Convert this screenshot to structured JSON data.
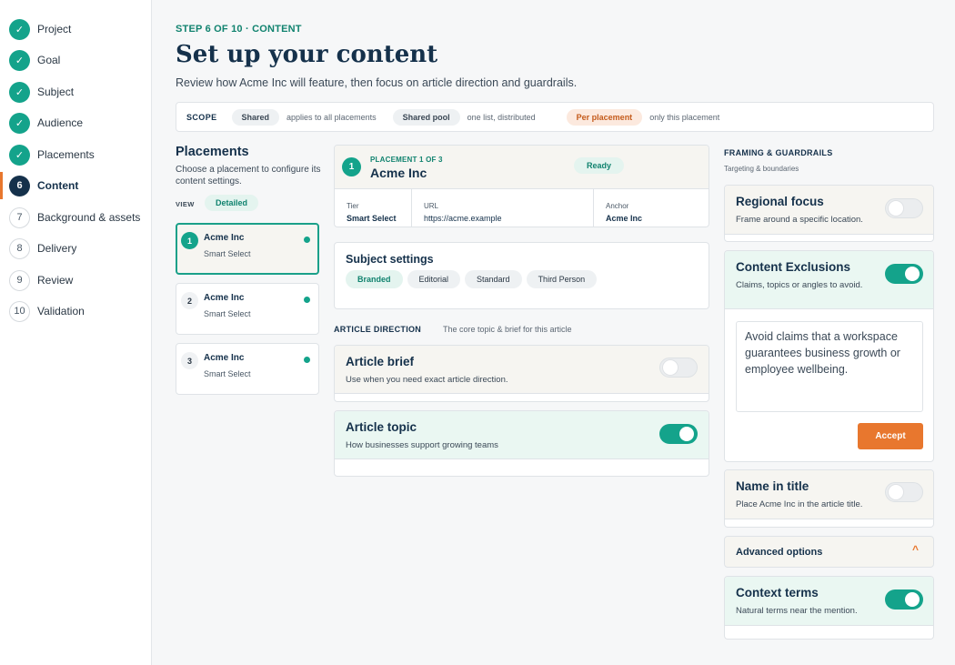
{
  "sidebar": {
    "steps": [
      {
        "num": "1",
        "label": "Project",
        "state": "done"
      },
      {
        "num": "2",
        "label": "Goal",
        "state": "done"
      },
      {
        "num": "3",
        "label": "Subject",
        "state": "done"
      },
      {
        "num": "4",
        "label": "Audience",
        "state": "done"
      },
      {
        "num": "5",
        "label": "Placements",
        "state": "done"
      },
      {
        "num": "6",
        "label": "Content",
        "state": "active"
      },
      {
        "num": "7",
        "label": "Background & assets",
        "state": "pending"
      },
      {
        "num": "8",
        "label": "Delivery",
        "state": "pending"
      },
      {
        "num": "9",
        "label": "Review",
        "state": "pending"
      },
      {
        "num": "10",
        "label": "Validation",
        "state": "pending"
      }
    ],
    "check": "✓"
  },
  "header": {
    "eyebrow": "STEP 6 OF 10 · CONTENT",
    "title": "Set up your content",
    "subtitle": "Review how Acme Inc will feature, then focus on article direction and guardrails."
  },
  "scope": {
    "label": "SCOPE",
    "shared": "Shared",
    "shared_desc": "applies to all placements",
    "pool": "Shared pool",
    "pool_desc": "one list, distributed",
    "per": "Per placement",
    "per_desc": "only this placement"
  },
  "placements": {
    "title": "Placements",
    "desc": "Choose a placement to configure its content settings.",
    "view_label": "VIEW",
    "view_value": "Detailed",
    "items": [
      {
        "num": "1",
        "name": "Acme Inc",
        "tier": "Smart Select"
      },
      {
        "num": "2",
        "name": "Acme Inc",
        "tier": "Smart Select"
      },
      {
        "num": "3",
        "name": "Acme Inc",
        "tier": "Smart Select"
      }
    ]
  },
  "placement_detail": {
    "num": "1",
    "eyebrow": "PLACEMENT 1 OF 3",
    "name": "Acme Inc",
    "status": "Ready",
    "tier_label": "Tier",
    "tier_value": "Smart Select",
    "url_label": "URL",
    "url_value": "https://acme.example",
    "anchor_label": "Anchor",
    "anchor_value": "Acme Inc"
  },
  "subject_settings": {
    "title": "Subject settings",
    "tags": [
      "Branded",
      "Editorial",
      "Standard",
      "Third Person"
    ]
  },
  "article_direction": {
    "label": "ARTICLE DIRECTION",
    "desc": "The core topic & brief for this article",
    "brief": {
      "title": "Article brief",
      "desc": "Use when you need exact article direction.",
      "on": false
    },
    "topic": {
      "title": "Article topic",
      "desc": "How businesses support growing teams",
      "on": true
    }
  },
  "framing": {
    "label": "FRAMING & GUARDRAILS",
    "desc": "Targeting & boundaries",
    "regional": {
      "title": "Regional focus",
      "desc": "Frame around a specific location.",
      "on": false
    },
    "exclusions": {
      "title": "Content Exclusions",
      "desc": "Claims, topics or angles to avoid.",
      "on": true,
      "text": "Avoid claims that a workspace guarantees business growth or employee wellbeing.",
      "accept": "Accept"
    },
    "name_in_title": {
      "title": "Name in title",
      "desc": "Place Acme Inc in the article title.",
      "on": false
    },
    "advanced": {
      "title": "Advanced options",
      "chevron": "^"
    },
    "context": {
      "title": "Context terms",
      "desc": "Natural terms near the mention.",
      "on": true
    }
  },
  "colors": {
    "accent": "#14a38b",
    "navy": "#15314b",
    "orange": "#e8772e"
  }
}
